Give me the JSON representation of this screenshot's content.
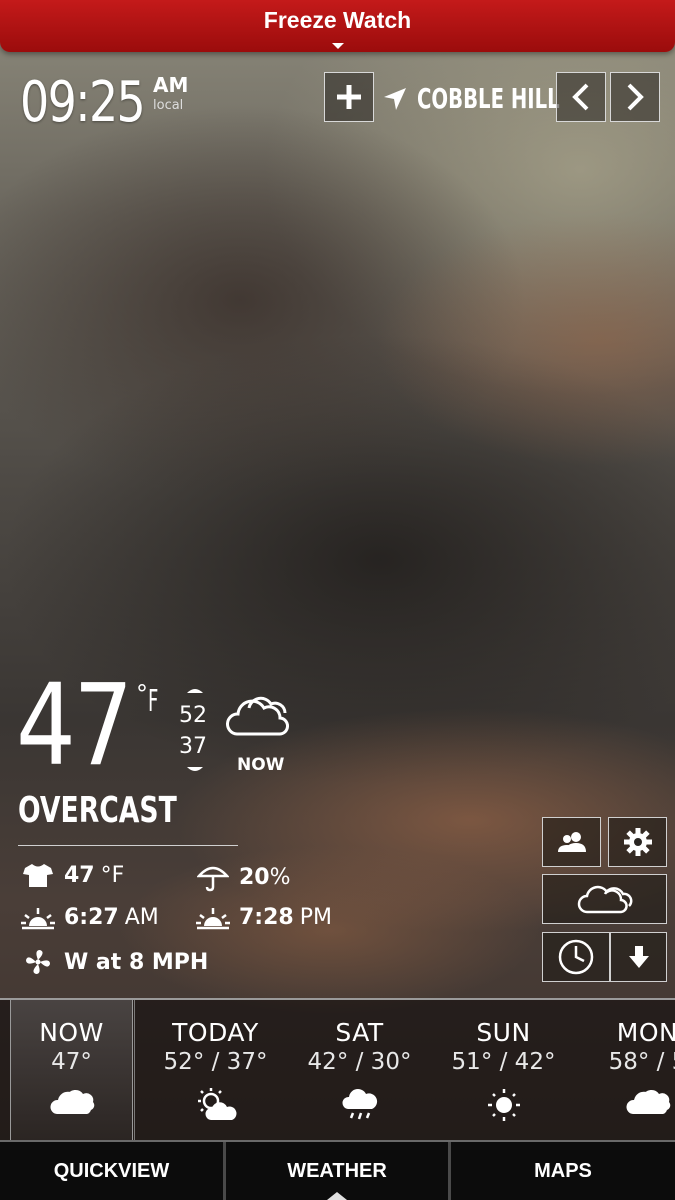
{
  "alert": {
    "text": "Freeze Watch"
  },
  "header": {
    "time": "09:25",
    "ampm": "AM",
    "timezone": "local",
    "location": "COBBLE HILL"
  },
  "current": {
    "temp": "47",
    "degree_symbol": "°",
    "unit": "F",
    "high": "52",
    "low": "37",
    "now_label": "NOW",
    "condition": "OVERCAST",
    "feels_like": {
      "value": "47",
      "unit": "°F"
    },
    "precip": {
      "value": "20",
      "unit": "%"
    },
    "sunrise": {
      "value": "6:27",
      "unit": "AM"
    },
    "sunset": {
      "value": "7:28",
      "unit": "PM"
    },
    "wind": "W at 8 MPH"
  },
  "forecast": [
    {
      "day": "NOW",
      "temps": "47°",
      "icon": "cloudy-icon"
    },
    {
      "day": "TODAY",
      "temps": "52° / 37°",
      "icon": "partly-sunny-icon"
    },
    {
      "day": "SAT",
      "temps": "42° / 30°",
      "icon": "rain-icon"
    },
    {
      "day": "SUN",
      "temps": "51° / 42°",
      "icon": "sunny-icon"
    },
    {
      "day": "MON",
      "temps": "58° / 5",
      "icon": "cloudy-icon"
    }
  ],
  "tabs": {
    "quickview": "QUICKVIEW",
    "weather": "WEATHER",
    "maps": "MAPS"
  },
  "colors": {
    "alert_red": "#b31212",
    "tab_bar": "#0c0c0c"
  }
}
